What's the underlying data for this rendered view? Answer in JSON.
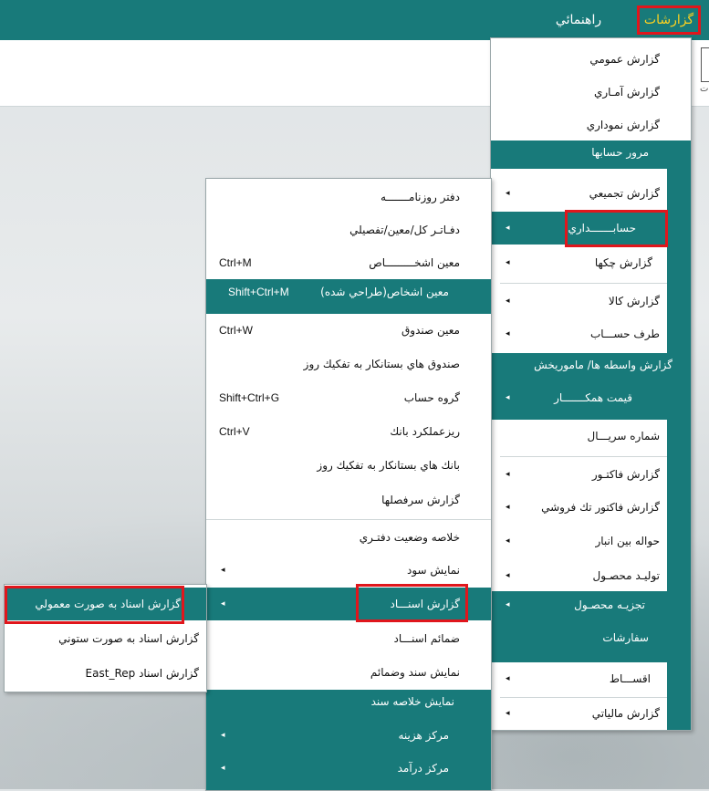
{
  "topbar": {
    "reports": "گزارشات",
    "help": "راهنمائي"
  },
  "toolbar": {
    "label": "ت"
  },
  "menu1": [
    {
      "label": "گزارش عمومي"
    },
    {
      "label": "گزارش آمـاري"
    },
    {
      "label": "گزارش نموداري"
    },
    {
      "label": "مرور حسابها"
    },
    {
      "label": "گزارش تجميعي"
    },
    {
      "label": "حسابـــــــداري"
    },
    {
      "label": "گزارش چكها"
    },
    {
      "label": "گزارش كالا"
    },
    {
      "label": "طرف حســـاب"
    },
    {
      "label": "گزارش واسطه ها/ ماموريخش"
    },
    {
      "label": "قيمت همكـــــــار"
    },
    {
      "label": "شماره سريـــال"
    },
    {
      "label": "گزارش فاكتـور"
    },
    {
      "label": "گزارش فاكتور تك فروشي"
    },
    {
      "label": "حواله بين انبار"
    },
    {
      "label": "توليـد محصـول"
    },
    {
      "label": "تجزيـه محصـول"
    },
    {
      "label": "سفارشات"
    },
    {
      "label": "اقســـاط"
    },
    {
      "label": "گزارش مالياتي"
    }
  ],
  "menu2": [
    {
      "label": "دفتر روزنامـــــــه",
      "shortcut": ""
    },
    {
      "label": "دفـاتـر كل/معين/تفصيلي",
      "shortcut": ""
    },
    {
      "label": "معين اشخـــــــــاص",
      "shortcut": "Ctrl+M"
    },
    {
      "label": "معين اشخاص(طراحي شده)",
      "shortcut": "Shift+Ctrl+M"
    },
    {
      "label": "معين صندوق",
      "shortcut": "Ctrl+W"
    },
    {
      "label": "صندوق هاي بستانكار به تفكيك روز",
      "shortcut": ""
    },
    {
      "label": "گروه حساب",
      "shortcut": "Shift+Ctrl+G"
    },
    {
      "label": "ريزعملكرد بانك",
      "shortcut": "Ctrl+V"
    },
    {
      "label": "بانك هاي بستانكار به تفكيك روز",
      "shortcut": ""
    },
    {
      "label": "گزارش سرفصلها",
      "shortcut": ""
    },
    {
      "label": "خلاصه وضعيت دفتـري",
      "shortcut": ""
    },
    {
      "label": "نمايش سود",
      "shortcut": ""
    },
    {
      "label": "گزارش   اسنـــاد",
      "shortcut": ""
    },
    {
      "label": "ضمائم اسنـــاد",
      "shortcut": ""
    },
    {
      "label": "نمايش سند وضمائم",
      "shortcut": ""
    },
    {
      "label": "نمايش خلاصه سند",
      "shortcut": ""
    },
    {
      "label": "مركز هزينه",
      "shortcut": ""
    },
    {
      "label": "مركز درآمد",
      "shortcut": ""
    }
  ],
  "menu3": [
    {
      "label": "گزارش اسناد به صورت معمولي"
    },
    {
      "label": "گزارش اسناد به صورت ستوني"
    },
    {
      "label": "گزارش اسناد East_Rep"
    }
  ],
  "icons": {
    "submenu_arrow": "◂"
  },
  "colors": {
    "teal": "#187a7a",
    "accent": "#ffd21f",
    "highlight_border": "#e0161c"
  }
}
